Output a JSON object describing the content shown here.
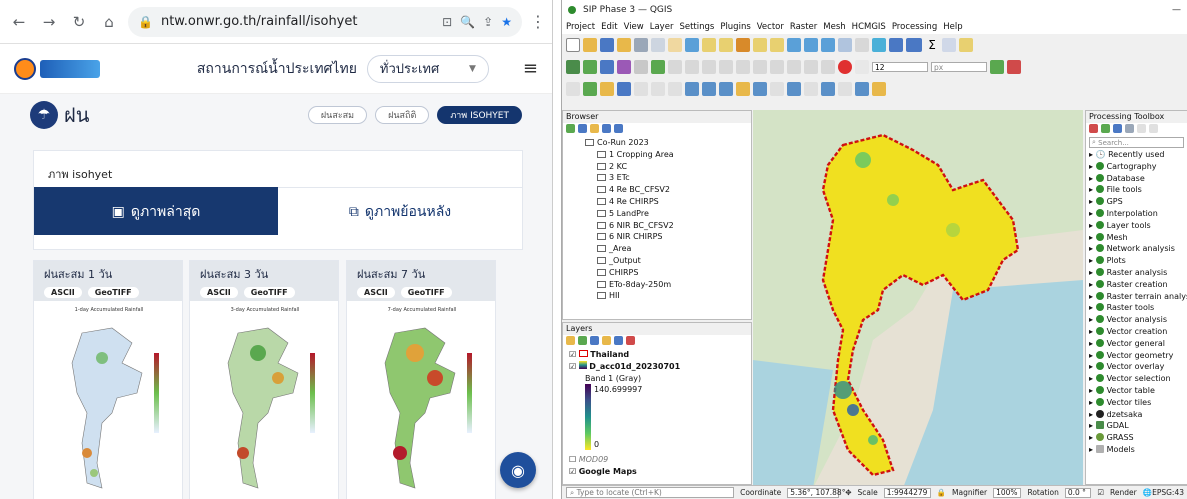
{
  "browser": {
    "url": "ntw.onwr.go.th/rainfall/isohyet"
  },
  "site": {
    "title": "สถานการณ์น้ำประเทศไทย",
    "region_select": "ทั่วประเทศ"
  },
  "rain_section": {
    "title": "ฝน",
    "pills": [
      "ฝนสะสม",
      "ฝนสถิติ",
      "ภาพ ISOHYET"
    ],
    "card_title": "ภาพ isohyet",
    "tab_latest": "ดูภาพล่าสุด",
    "tab_history": "ดูภาพย้อนหลัง"
  },
  "mini_cards": [
    {
      "title": "ฝนสะสม 1 วัน",
      "btn1": "ASCII",
      "btn2": "GeoTIFF",
      "map_caption": "1-day Accumulated Rainfall"
    },
    {
      "title": "ฝนสะสม 3 วัน",
      "btn1": "ASCII",
      "btn2": "GeoTIFF",
      "map_caption": "3-day Accumulated Rainfall"
    },
    {
      "title": "ฝนสะสม 7 วัน",
      "btn1": "ASCII",
      "btn2": "GeoTIFF",
      "map_caption": "7-day Accumulated Rainfall"
    }
  ],
  "qgis": {
    "window_title": "SIP Phase 3 — QGIS",
    "menu": [
      "Project",
      "Edit",
      "View",
      "Layer",
      "Settings",
      "Plugins",
      "Vector",
      "Raster",
      "Mesh",
      "HCMGIS",
      "Processing",
      "Help"
    ],
    "toolbar_font_size": "12",
    "toolbar_unit": "px",
    "browser_title": "Browser",
    "browser_items": [
      "Co-Run 2023",
      "1 Cropping Area",
      "2 KC",
      "3 ETc",
      "4 Re BC_CFSV2",
      "4 Re CHIRPS",
      "5 LandPre",
      "6 NIR BC_CFSV2",
      "6 NIR CHIRPS",
      "_Area",
      "_Output",
      "CHIRPS",
      "ETo-8day-250m",
      "HII"
    ],
    "layers_title": "Layers",
    "layers": [
      {
        "name": "Thailand",
        "bold": true
      },
      {
        "name": "D_acc01d_20230701",
        "bold": true
      },
      {
        "name": "MOD09",
        "bold": false
      },
      {
        "name": "Google Maps",
        "bold": true
      }
    ],
    "band_label": "Band 1 (Gray)",
    "band_max": "140.699997",
    "band_min": "0",
    "toolbox_title": "Processing Toolbox",
    "toolbox_search": "Search...",
    "toolbox_items": [
      "Recently used",
      "Cartography",
      "Database",
      "File tools",
      "GPS",
      "Interpolation",
      "Layer tools",
      "Mesh",
      "Network analysis",
      "Plots",
      "Raster analysis",
      "Raster creation",
      "Raster terrain analysis",
      "Raster tools",
      "Vector analysis",
      "Vector creation",
      "Vector general",
      "Vector geometry",
      "Vector overlay",
      "Vector selection",
      "Vector table",
      "Vector tiles",
      "dzetsaka",
      "GDAL",
      "GRASS",
      "Models"
    ],
    "status": {
      "locate_placeholder": "Type to locate (Ctrl+K)",
      "coordinate_label": "Coordinate",
      "coordinate": "5.36°, 107.88°",
      "scale_label": "Scale",
      "scale": "1:9944279",
      "magnifier_label": "Magnifier",
      "magnifier": "100%",
      "rotation_label": "Rotation",
      "rotation": "0.0 °",
      "render_label": "Render",
      "crs": "EPSG:43"
    }
  }
}
